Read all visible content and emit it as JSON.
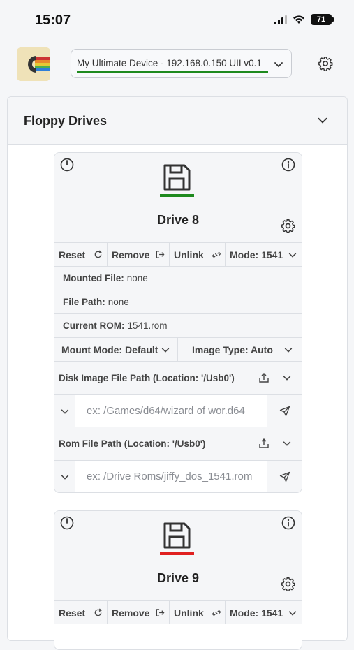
{
  "status": {
    "time": "15:07",
    "battery": "71"
  },
  "header": {
    "device_label": "My Ultimate Device - 192.168.0.150 UII v0.1",
    "connection_color": "#1e8a1e"
  },
  "panel": {
    "title": "Floppy Drives"
  },
  "drives": [
    {
      "name": "Drive 8",
      "status_color": "#1e8a1e",
      "buttons": {
        "reset": "Reset",
        "remove": "Remove",
        "unlink": "Unlink",
        "mode": "Mode: 1541"
      },
      "mounted_file_label": "Mounted File:",
      "mounted_file": "none",
      "file_path_label": "File Path:",
      "file_path": "none",
      "current_rom_label": "Current ROM:",
      "current_rom": "1541.rom",
      "mount_mode": "Mount Mode: Default",
      "image_type": "Image Type: Auto",
      "disk_path_label": "Disk Image File Path (Location: '/Usb0')",
      "disk_path_placeholder": "ex: /Games/d64/wizard of wor.d64",
      "rom_path_label": "Rom File Path (Location: '/Usb0')",
      "rom_path_placeholder": "ex: /Drive Roms/jiffy_dos_1541.rom"
    },
    {
      "name": "Drive 9",
      "status_color": "#e02020",
      "buttons": {
        "reset": "Reset",
        "remove": "Remove",
        "unlink": "Unlink",
        "mode": "Mode: 1541"
      }
    }
  ]
}
